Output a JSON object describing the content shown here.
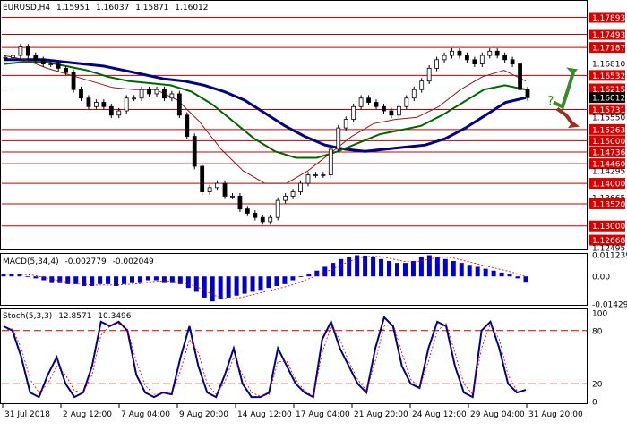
{
  "header": {
    "symbol": "EURUSD,H4",
    "open": "1.15951",
    "high": "1.16037",
    "low": "1.15871",
    "close": "1.16012"
  },
  "macd_label": {
    "name": "MACD(5,34,4)",
    "value1": "-0.002779",
    "value2": "-0.002049"
  },
  "stoch_label": {
    "name": "Stoch(5,3,3)",
    "value1": "12.8571",
    "value2": "10.3496"
  },
  "chart_data": [
    {
      "type": "candlestick",
      "title": "EURUSD,H4 1.15951 1.16037 1.15871 1.16012",
      "ylim": [
        1.1247,
        1.1826
      ],
      "price_ticks": [
        "1.17893",
        "1.17493",
        "1.17187",
        "1.16810",
        "1.16532",
        "1.16215",
        "1.16012",
        "1.15731",
        "1.15550",
        "1.15263",
        "1.15000",
        "1.14736",
        "1.14460",
        "1.14295",
        "1.14000",
        "1.13665",
        "1.13520",
        "1.13000",
        "1.12668",
        "1.12495"
      ],
      "support_resistance_levels": [
        1.17893,
        1.17493,
        1.17187,
        1.16532,
        1.16215,
        1.15731,
        1.15263,
        1.15,
        1.14736,
        1.1446,
        1.14,
        1.1352,
        1.13,
        1.12668
      ],
      "highlighted_levels": [
        "1.17893",
        "1.17493",
        "1.17187",
        "1.16532",
        "1.16215",
        "1.15731",
        "1.15263",
        "1.15000",
        "1.14736",
        "1.14460",
        "1.14000",
        "1.13520",
        "1.13000",
        "1.12668"
      ],
      "current_price": "1.16012",
      "x_labels": [
        "31 Jul 2018",
        "2 Aug 12:00",
        "7 Aug 04:00",
        "9 Aug 20:00",
        "14 Aug 12:00",
        "17 Aug 04:00",
        "21 Aug 20:00",
        "24 Aug 12:00",
        "29 Aug 04:00",
        "31 Aug 20:00"
      ],
      "close_path": [
        1.1695,
        1.17,
        1.172,
        1.17,
        1.169,
        1.168,
        1.168,
        1.167,
        1.166,
        1.162,
        1.16,
        1.158,
        1.159,
        1.158,
        1.156,
        1.157,
        1.16,
        1.16,
        1.162,
        1.161,
        1.162,
        1.16,
        1.161,
        1.156,
        1.151,
        1.144,
        1.138,
        1.139,
        1.14,
        1.137,
        1.137,
        1.134,
        1.133,
        1.132,
        1.131,
        1.132,
        1.136,
        1.137,
        1.138,
        1.14,
        1.142,
        1.142,
        1.142,
        1.148,
        1.153,
        1.155,
        1.158,
        1.16,
        1.159,
        1.158,
        1.157,
        1.156,
        1.158,
        1.16,
        1.162,
        1.164,
        1.167,
        1.169,
        1.17,
        1.171,
        1.17,
        1.169,
        1.168,
        1.17,
        1.171,
        1.17,
        1.169,
        1.168,
        1.162,
        1.1601
      ],
      "series": [
        {
          "name": "",
          "color": "#000080",
          "values": [
            1.169,
            1.169,
            1.169,
            1.1685,
            1.168,
            1.1675,
            1.1665,
            1.1655,
            1.1645,
            1.164,
            1.163,
            1.1615,
            1.1595,
            1.1565,
            1.1535,
            1.151,
            1.149,
            1.148,
            1.1475,
            1.148,
            1.1485,
            1.149,
            1.1505,
            1.153,
            1.156,
            1.159,
            1.1601
          ]
        },
        {
          "name": "",
          "color": "#006400",
          "values": [
            1.168,
            1.1685,
            1.1685,
            1.1675,
            1.1665,
            1.165,
            1.164,
            1.1635,
            1.163,
            1.1615,
            1.1585,
            1.1545,
            1.1505,
            1.1475,
            1.146,
            1.146,
            1.1475,
            1.1495,
            1.1515,
            1.1525,
            1.1535,
            1.156,
            1.159,
            1.162,
            1.163,
            1.162
          ]
        },
        {
          "name": "",
          "color": "#8b1a1a",
          "values": [
            1.17,
            1.169,
            1.167,
            1.1655,
            1.164,
            1.1625,
            1.162,
            1.162,
            1.1595,
            1.1545,
            1.148,
            1.143,
            1.14,
            1.14,
            1.143,
            1.147,
            1.151,
            1.154,
            1.155,
            1.1555,
            1.158,
            1.162,
            1.165,
            1.1665,
            1.164
          ]
        }
      ],
      "forecast_arrows": [
        "up",
        "down"
      ],
      "forecast_question": "?"
    },
    {
      "type": "bar",
      "title": "MACD(5,34,4) -0.002779 -0.002049",
      "ylim": [
        -0.014291,
        0.011239
      ],
      "ticks": [
        "0.011239",
        "0.00",
        "-0.014291"
      ],
      "values": [
        0.001,
        0.0015,
        0.001,
        0.0,
        -0.001,
        -0.002,
        -0.003,
        -0.003,
        -0.004,
        -0.004,
        -0.005,
        -0.005,
        -0.004,
        -0.004,
        -0.005,
        -0.004,
        -0.003,
        -0.003,
        -0.002,
        -0.002,
        -0.003,
        -0.003,
        -0.004,
        -0.006,
        -0.008,
        -0.011,
        -0.013,
        -0.012,
        -0.011,
        -0.01,
        -0.009,
        -0.008,
        -0.007,
        -0.006,
        -0.005,
        -0.004,
        -0.002,
        0.0,
        0.001,
        0.003,
        0.005,
        0.007,
        0.009,
        0.01,
        0.011,
        0.0108,
        0.01,
        0.009,
        0.008,
        0.007,
        0.007,
        0.008,
        0.01,
        0.011,
        0.01,
        0.009,
        0.008,
        0.007,
        0.006,
        0.005,
        0.004,
        0.003,
        0.002,
        0.001,
        -0.001,
        -0.0028
      ]
    },
    {
      "type": "line",
      "title": "Stoch(5,3,3) 12.8571 10.3496",
      "ylim": [
        0,
        100
      ],
      "ticks": [
        "100",
        "80",
        "20",
        "0"
      ],
      "levels": [
        80,
        20
      ],
      "series": [
        {
          "name": "",
          "color": "#000080",
          "values": [
            85,
            80,
            50,
            10,
            5,
            30,
            50,
            20,
            5,
            10,
            40,
            90,
            85,
            90,
            80,
            30,
            10,
            5,
            10,
            8,
            50,
            85,
            40,
            10,
            5,
            30,
            60,
            20,
            5,
            5,
            10,
            60,
            40,
            20,
            10,
            5,
            70,
            90,
            60,
            40,
            20,
            10,
            60,
            95,
            85,
            40,
            20,
            15,
            60,
            90,
            85,
            40,
            10,
            5,
            80,
            90,
            60,
            20,
            10,
            13
          ]
        },
        {
          "name": "",
          "color": "#c00000",
          "values": [
            80,
            82,
            60,
            25,
            10,
            20,
            40,
            30,
            12,
            10,
            30,
            75,
            85,
            88,
            82,
            45,
            18,
            8,
            9,
            9,
            35,
            70,
            55,
            20,
            8,
            22,
            50,
            30,
            10,
            6,
            8,
            45,
            45,
            25,
            12,
            6,
            55,
            85,
            70,
            45,
            25,
            12,
            45,
            85,
            88,
            55,
            25,
            16,
            45,
            80,
            88,
            55,
            20,
            8,
            60,
            88,
            70,
            30,
            12,
            10
          ]
        }
      ]
    }
  ]
}
